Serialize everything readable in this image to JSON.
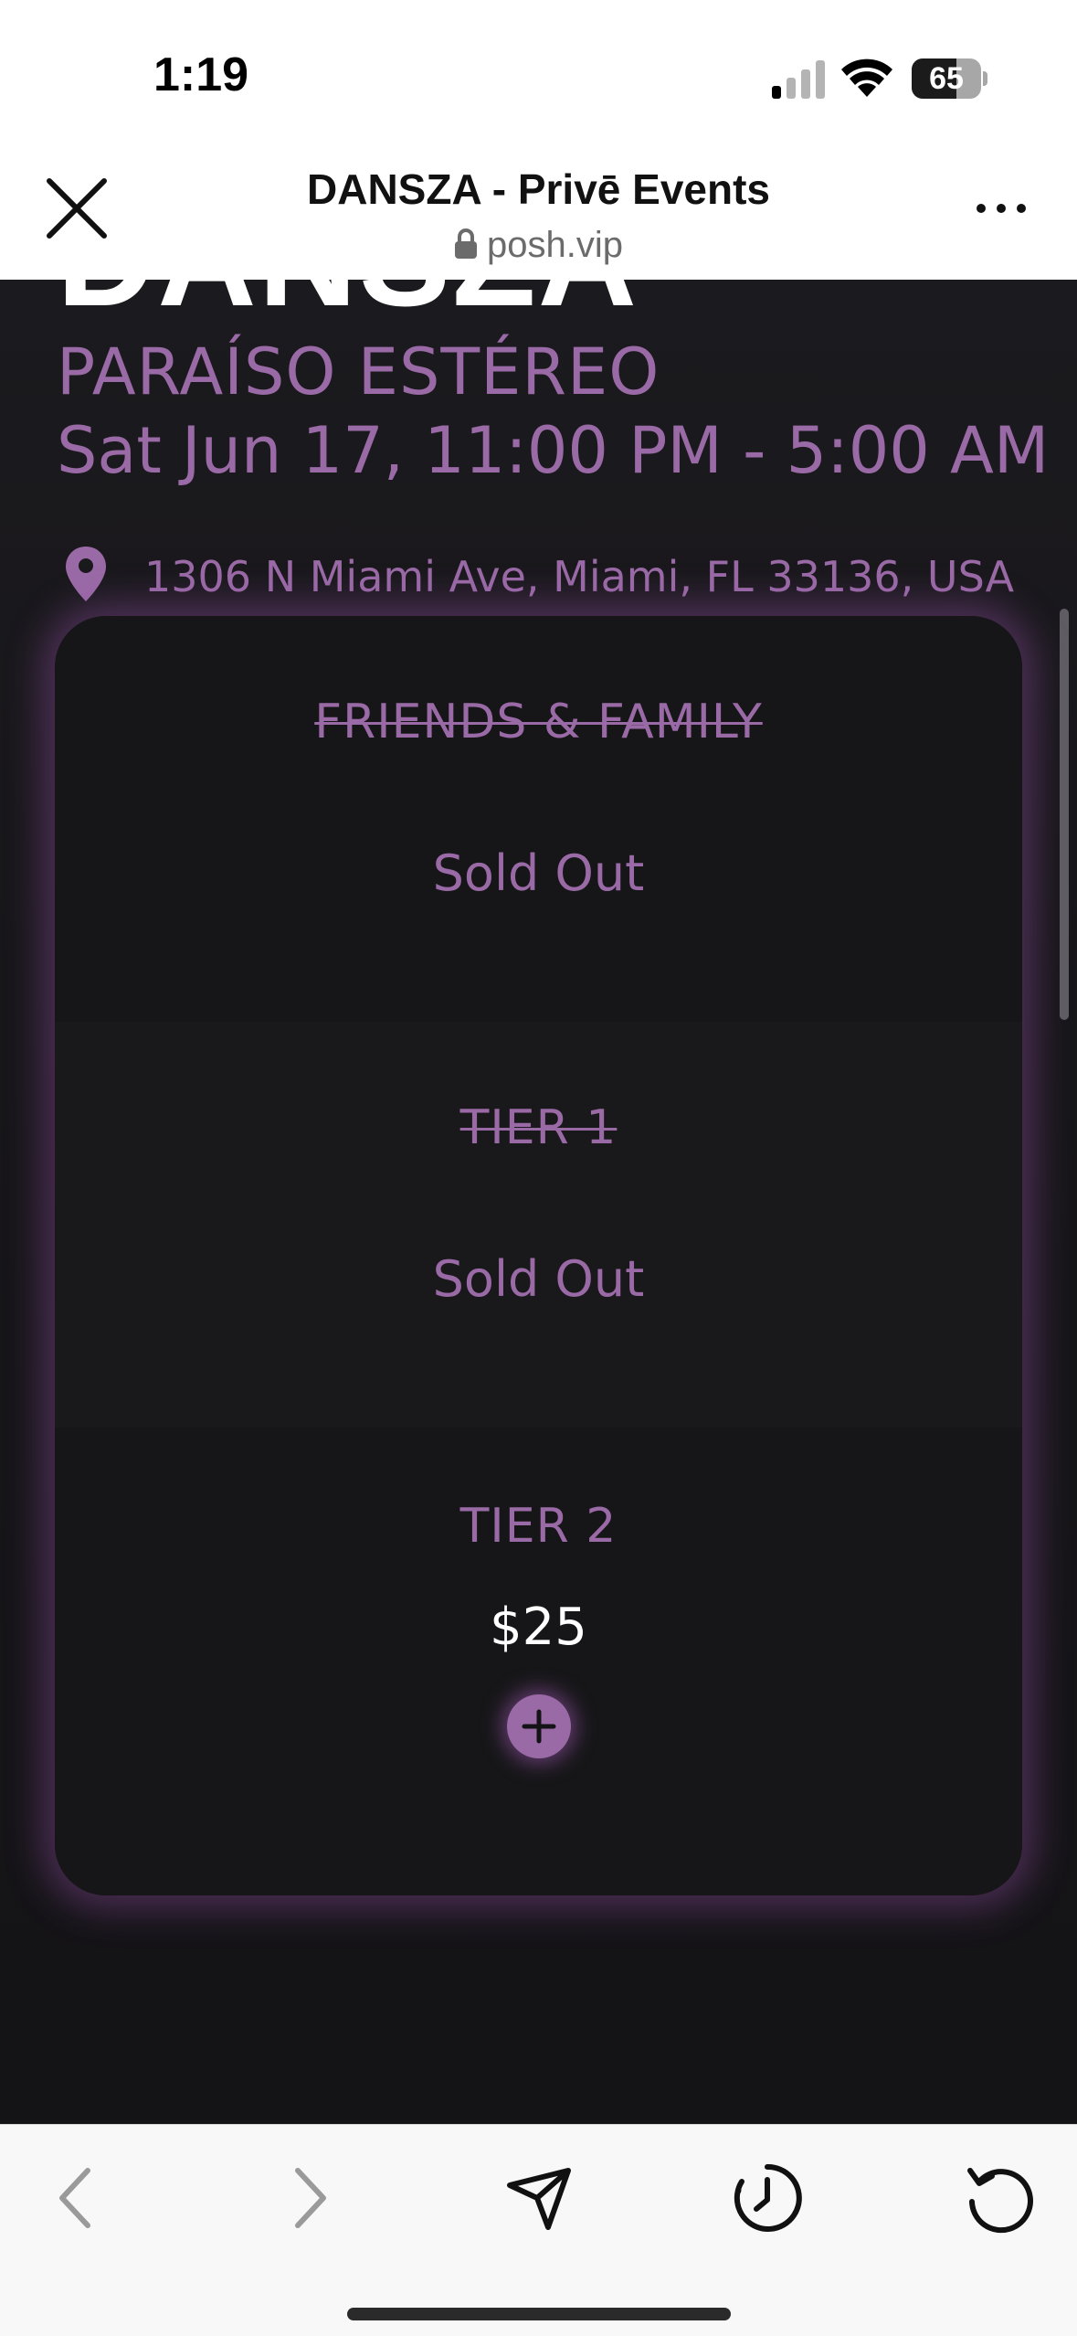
{
  "status_bar": {
    "time": "1:19",
    "battery_level": "65",
    "battery_fraction": 0.65,
    "signal_bars_active": 1
  },
  "browser": {
    "page_title": "DANSZA - Privē Events",
    "url": "posh.vip"
  },
  "event": {
    "brand_partial": "DANSZA",
    "venue": "PARAÍSO ESTÉREO",
    "date_time": "Sat Jun 17, 11:00 PM - 5:00 AM",
    "address": "1306 N Miami Ave, Miami, FL 33136, USA"
  },
  "tickets": [
    {
      "name": "FRIENDS & FAMILY",
      "status": "Sold Out",
      "sold_out": true
    },
    {
      "name": "TIER 1",
      "status": "Sold Out",
      "sold_out": true
    },
    {
      "name": "TIER 2",
      "price": "$25",
      "sold_out": false
    }
  ],
  "colors": {
    "accent": "#9a6aa6",
    "background": "#141316",
    "card": "#161618",
    "glow": "#9650aa"
  },
  "icons": {
    "close": "close-icon",
    "lock": "lock-icon",
    "more": "more-icon",
    "pin": "location-pin-icon",
    "add": "plus-icon",
    "back": "chevron-left-icon",
    "forward": "chevron-right-icon",
    "share": "send-icon",
    "history": "history-icon",
    "reload": "reload-icon"
  }
}
